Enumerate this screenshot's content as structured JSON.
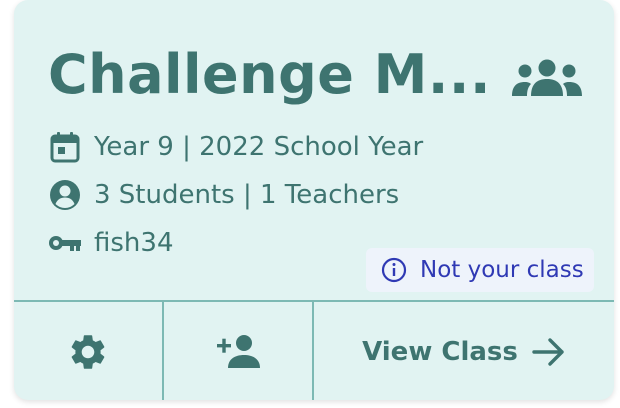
{
  "card": {
    "title": "Challenge M...",
    "year_line": "Year 9 | 2022 School Year",
    "people_line": "3 Students | 1 Teachers",
    "class_code": "fish34",
    "badge_text": "Not your class",
    "view_button_label": "View Class"
  },
  "colors": {
    "card_bg": "#e1f3f2",
    "teal": "#3e7470",
    "divider": "#7db9b4",
    "badge_bg": "#eef3fb",
    "badge_text": "#2f39b4"
  },
  "icons": {
    "group": "group-icon",
    "calendar": "calendar-icon",
    "account": "account-circle-icon",
    "key": "key-icon",
    "info": "info-icon",
    "settings": "gear-icon",
    "add_person": "person-add-icon",
    "arrow": "arrow-right-icon"
  }
}
